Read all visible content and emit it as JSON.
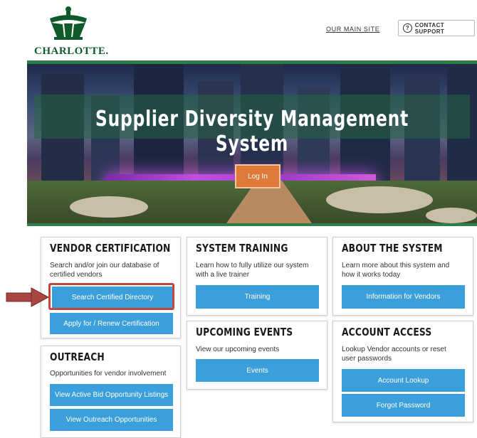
{
  "header": {
    "logo_text": "CHARLOTTE.",
    "main_site_link": "OUR MAIN SITE",
    "contact_support": "CONTACT SUPPORT"
  },
  "hero": {
    "title": "Supplier Diversity Management System",
    "login_button": "Log In"
  },
  "vendor_certification": {
    "title": "VENDOR CERTIFICATION",
    "description_line1": "Search and/or join our database of",
    "description_line2": "certified vendors",
    "search_button": "Search Certified Directory",
    "apply_button": "Apply for / Renew Certification"
  },
  "outreach": {
    "title": "OUTREACH",
    "description": "Opportunities for vendor involvement",
    "bid_button": "View Active Bid Opportunity Listings",
    "outreach_button": "View Outreach Opportunities"
  },
  "system_training": {
    "title": "SYSTEM TRAINING",
    "description_line1": "Learn how to fully utilize our system",
    "description_line2": "with a live trainer",
    "button": "Training"
  },
  "upcoming_events": {
    "title": "UPCOMING EVENTS",
    "description": "View our upcoming events",
    "button": "Events"
  },
  "about_system": {
    "title": "ABOUT THE SYSTEM",
    "description_line1": "Learn more about this system and",
    "description_line2": "how it works today",
    "button": "Information for Vendors"
  },
  "account_access": {
    "title": "ACCOUNT ACCESS",
    "description_line1": "Lookup Vendor accounts or reset",
    "description_line2": "user passwords",
    "lookup_button": "Account Lookup",
    "forgot_button": "Forgot Password"
  },
  "colors": {
    "brand_green": "#2e7d46",
    "button_blue": "#3b9fdb",
    "highlight_red": "#c0463e",
    "login_orange": "#e07a3a"
  }
}
